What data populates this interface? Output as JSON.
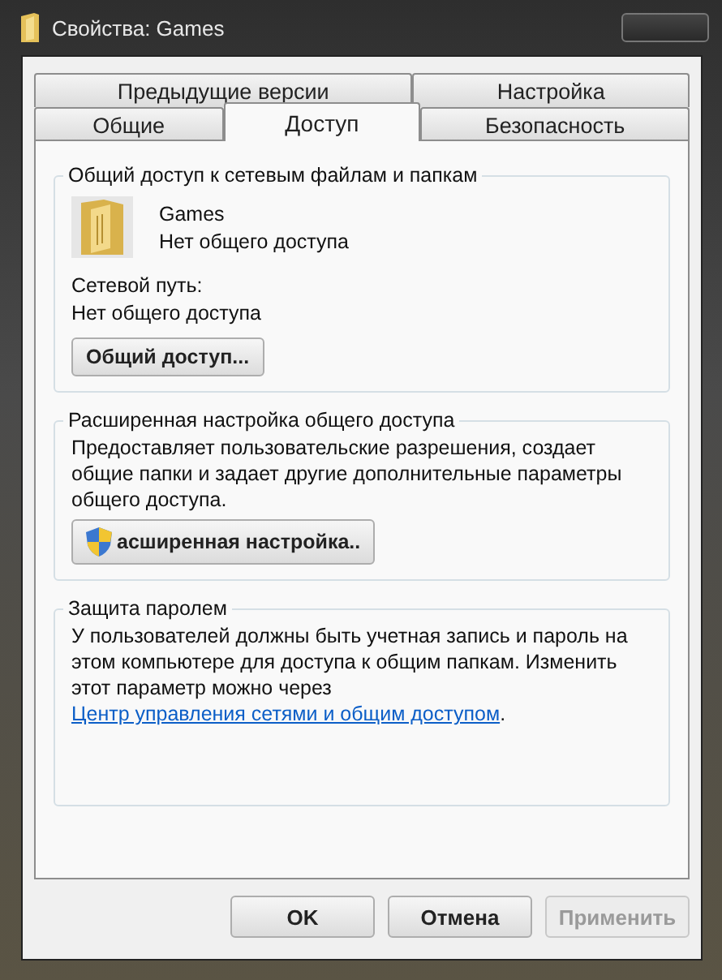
{
  "window": {
    "title": "Свойства: Games"
  },
  "tab_rows": [
    [
      {
        "label": "Предыдущие версии",
        "selected": false
      },
      {
        "label": "Настройка",
        "selected": false
      }
    ],
    [
      {
        "label": "Общие",
        "selected": false
      },
      {
        "label": "Доступ",
        "selected": true
      },
      {
        "label": "Безопасность",
        "selected": false
      }
    ]
  ],
  "sharing": {
    "title": "Общий доступ к сетевым файлам и папкам",
    "folder_name": "Games",
    "folder_status": "Нет общего доступа",
    "path_label": "Сетевой путь:",
    "path_value": "Нет общего доступа",
    "button": "Общий доступ..."
  },
  "advanced": {
    "title": "Расширенная настройка общего доступа",
    "description": "Предоставляет пользовательские разрешения, создает общие папки и задает другие дополнительные параметры общего доступа.",
    "button": "асширенная настройка.."
  },
  "password": {
    "title": "Защита паролем",
    "text": "У пользователей должны быть учетная запись и пароль на этом компьютере для доступа к общим папкам. Изменить этот параметр можно через",
    "link": "Центр управления сетями и общим доступом",
    "text_after": "."
  },
  "buttons": [
    {
      "label": "OK",
      "disabled": false
    },
    {
      "label": "Отмена",
      "disabled": false
    },
    {
      "label": "Применить",
      "disabled": true
    }
  ]
}
